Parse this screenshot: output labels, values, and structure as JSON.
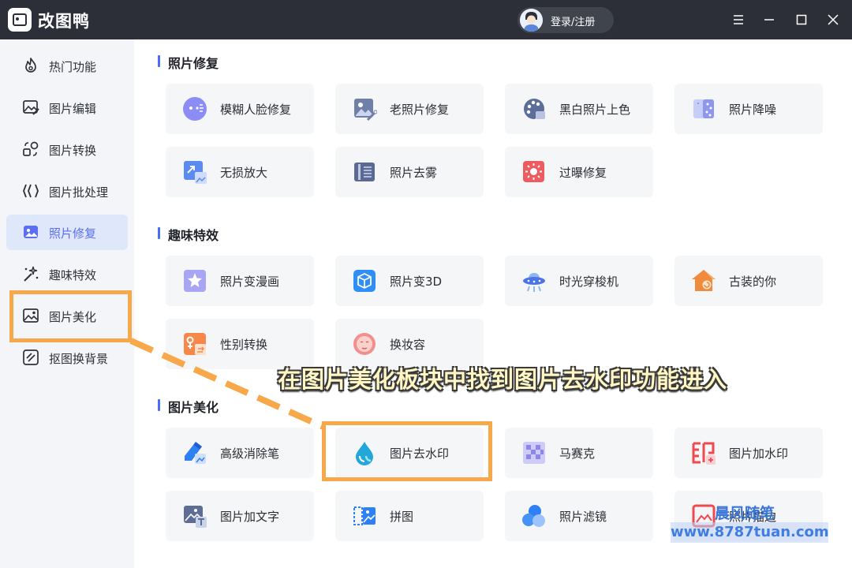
{
  "app": {
    "name": "改图鸭",
    "login": "登录/注册"
  },
  "sidebar": {
    "items": [
      {
        "label": "热门功能"
      },
      {
        "label": "图片编辑"
      },
      {
        "label": "图片转换"
      },
      {
        "label": "图片批处理"
      },
      {
        "label": "照片修复"
      },
      {
        "label": "趣味特效"
      },
      {
        "label": "图片美化"
      },
      {
        "label": "抠图换背景"
      }
    ],
    "active_index": 4
  },
  "sections": [
    {
      "title": "照片修复",
      "items": [
        {
          "label": "模糊人脸修复",
          "icon": "blur-face-icon"
        },
        {
          "label": "老照片修复",
          "icon": "old-photo-icon"
        },
        {
          "label": "黑白照片上色",
          "icon": "palette-icon"
        },
        {
          "label": "照片降噪",
          "icon": "denoise-icon"
        },
        {
          "label": "无损放大",
          "icon": "enlarge-icon"
        },
        {
          "label": "照片去雾",
          "icon": "dehaze-icon"
        },
        {
          "label": "过曝修复",
          "icon": "overexposure-icon"
        }
      ]
    },
    {
      "title": "趣味特效",
      "items": [
        {
          "label": "照片变漫画",
          "icon": "cartoon-icon"
        },
        {
          "label": "照片变3D",
          "icon": "cube-3d-icon"
        },
        {
          "label": "时光穿梭机",
          "icon": "ufo-icon"
        },
        {
          "label": "古装的你",
          "icon": "ancient-house-icon"
        },
        {
          "label": "性别转换",
          "icon": "gender-icon"
        },
        {
          "label": "换妆容",
          "icon": "makeup-face-icon"
        }
      ]
    },
    {
      "title": "图片美化",
      "items": [
        {
          "label": "高级消除笔",
          "icon": "eraser-pen-icon"
        },
        {
          "label": "图片去水印",
          "icon": "water-drop-icon"
        },
        {
          "label": "马赛克",
          "icon": "mosaic-icon"
        },
        {
          "label": "图片加水印",
          "icon": "add-watermark-icon"
        },
        {
          "label": "图片加文字",
          "icon": "add-text-icon"
        },
        {
          "label": "拼图",
          "icon": "collage-icon"
        },
        {
          "label": "照片滤镜",
          "icon": "filter-circles-icon"
        },
        {
          "label": "照片描边",
          "icon": "outline-icon"
        }
      ]
    }
  ],
  "annotation": {
    "banner": "在图片美化板块中找到图片去水印功能进入",
    "color": "#f7a84a"
  },
  "watermark": {
    "line1": "晨风随笔",
    "line2": "www.8787tuan.com"
  }
}
